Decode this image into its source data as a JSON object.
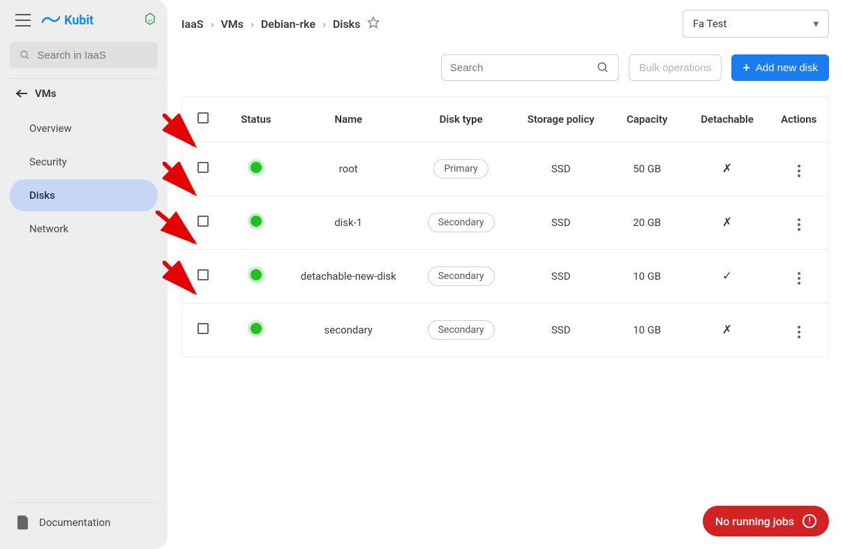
{
  "brand": {
    "name": "Kubit"
  },
  "sidebar": {
    "search_placeholder": "Search in IaaS",
    "back_label": "VMs",
    "items": [
      {
        "label": "Overview"
      },
      {
        "label": "Security"
      },
      {
        "label": "Disks"
      },
      {
        "label": "Network"
      }
    ],
    "documentation": "Documentation"
  },
  "breadcrumbs": {
    "items": [
      "IaaS",
      "VMs",
      "Debian-rke",
      "Disks"
    ]
  },
  "project_select": {
    "value": "Fa Test"
  },
  "toolbar": {
    "search_placeholder": "Search",
    "bulk_label": "Bulk operations",
    "add_label": "Add new disk"
  },
  "table": {
    "headers": {
      "status": "Status",
      "name": "Name",
      "disk_type": "Disk type",
      "storage_policy": "Storage policy",
      "capacity": "Capacity",
      "detachable": "Detachable",
      "actions": "Actions"
    },
    "rows": [
      {
        "name": "root",
        "disk_type": "Primary",
        "storage_policy": "SSD",
        "capacity": "50 GB",
        "detachable": "✗"
      },
      {
        "name": "disk-1",
        "disk_type": "Secondary",
        "storage_policy": "SSD",
        "capacity": "20 GB",
        "detachable": "✗"
      },
      {
        "name": "detachable-new-disk",
        "disk_type": "Secondary",
        "storage_policy": "SSD",
        "capacity": "10 GB",
        "detachable": "✓"
      },
      {
        "name": "secondary",
        "disk_type": "Secondary",
        "storage_policy": "SSD",
        "capacity": "10 GB",
        "detachable": "✗"
      }
    ]
  },
  "jobs_badge": "No running jobs"
}
